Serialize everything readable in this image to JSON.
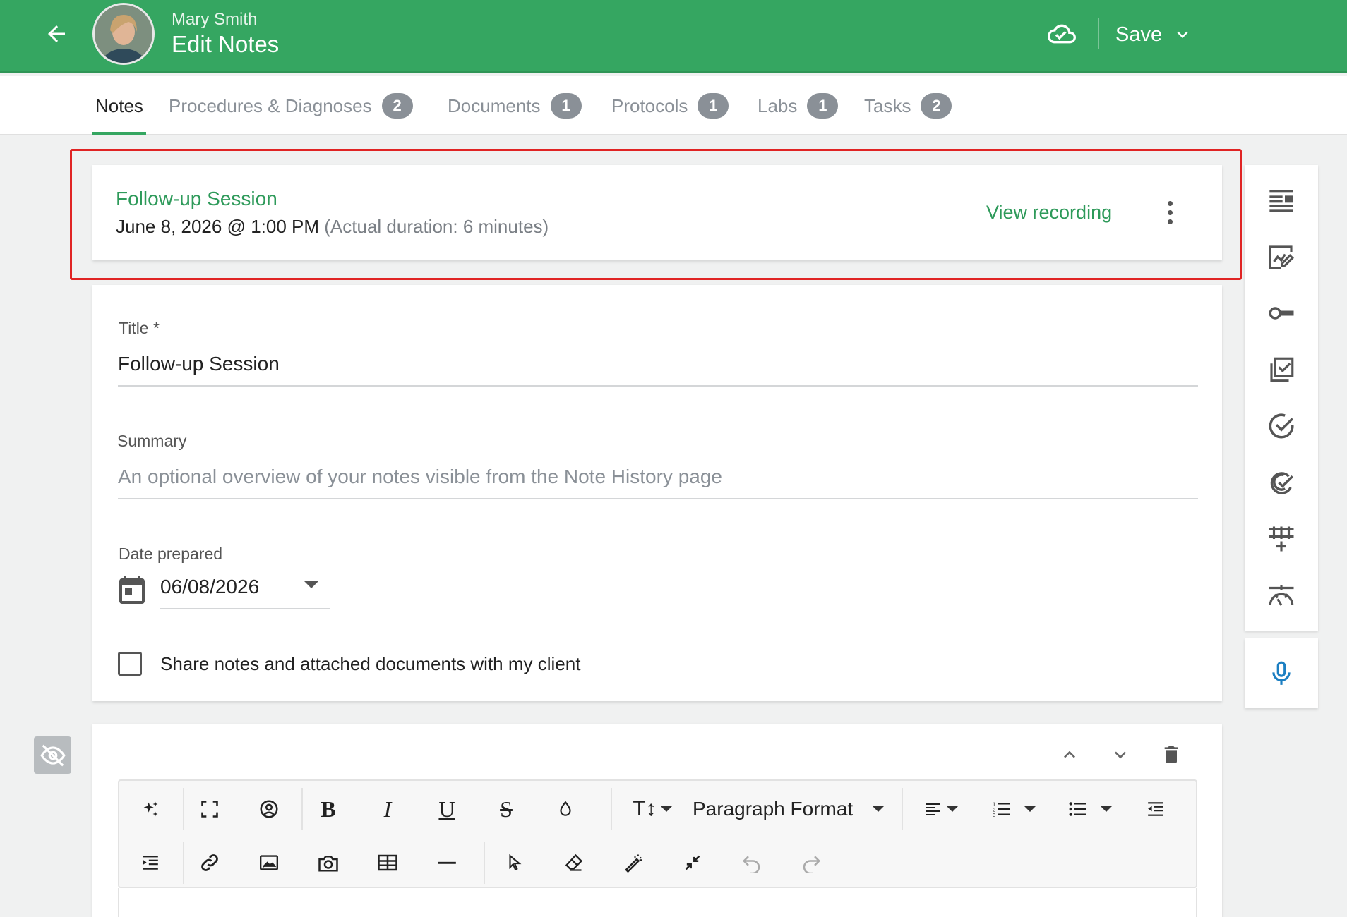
{
  "header": {
    "client_name": "Mary Smith",
    "page_title": "Edit Notes",
    "save_label": "Save",
    "icons": {
      "back": "arrow-left-icon",
      "cloud": "cloud-check-icon",
      "save_menu": "chevron-down-icon"
    },
    "colors": {
      "brand": "#35a661"
    }
  },
  "tabs": [
    {
      "label": "Notes",
      "active": true
    },
    {
      "label": "Procedures & Diagnoses",
      "badge": "2"
    },
    {
      "label": "Documents",
      "badge": "1"
    },
    {
      "label": "Protocols",
      "badge": "1"
    },
    {
      "label": "Labs",
      "badge": "1"
    },
    {
      "label": "Tasks",
      "badge": "2"
    }
  ],
  "session": {
    "title": "Follow-up Session",
    "date": "June 8, 2026 @ 1:00 PM",
    "duration": "(Actual duration: 6 minutes)",
    "view_recording": "View recording"
  },
  "form": {
    "title_label": "Title *",
    "title_value": "Follow-up Session",
    "summary_label": "Summary",
    "summary_placeholder": "An optional overview of your notes visible from the Note History page",
    "date_label": "Date prepared",
    "date_value": "06/08/2026",
    "share_label": "Share notes and attached documents with my client",
    "share_checked": false
  },
  "rail": {
    "icons": [
      "template-icon",
      "signature-icon",
      "key-icon",
      "checklist-icon",
      "check-circle-icon",
      "double-check-icon",
      "table-add-icon",
      "scale-icon"
    ],
    "mic_icon": "microphone-icon"
  },
  "editor": {
    "paragraph_format": "Paragraph Format",
    "controls": [
      "move-up-icon",
      "move-down-icon",
      "delete-icon"
    ],
    "toolbar_row1": [
      "ai-sparkle-icon",
      "fullscreen-icon",
      "mention-icon",
      "bold-icon",
      "italic-icon",
      "underline-icon",
      "strikethrough-icon",
      "text-color-icon",
      "font-size-icon",
      "align-icon",
      "ordered-list-icon",
      "unordered-list-icon",
      "outdent-icon"
    ],
    "toolbar_row2": [
      "indent-icon",
      "link-icon",
      "image-icon",
      "camera-icon",
      "table-icon",
      "horizontal-rule-icon",
      "select-icon",
      "clear-format-icon",
      "magic-wand-icon",
      "collapse-icon",
      "undo-icon",
      "redo-icon"
    ],
    "visibility_icon": "eye-off-icon"
  }
}
